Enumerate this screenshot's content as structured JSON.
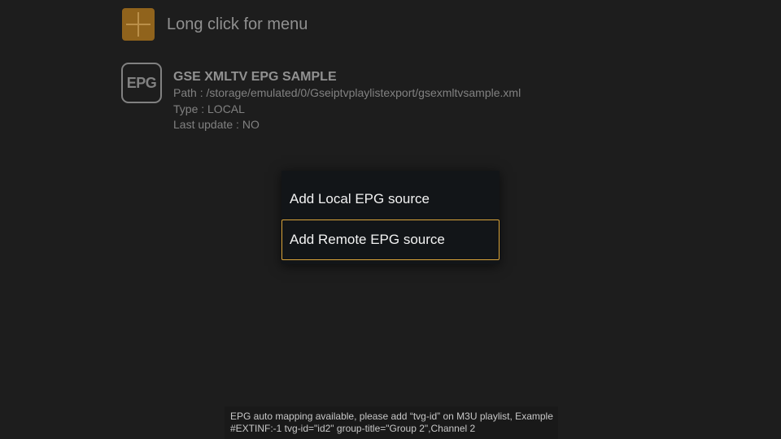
{
  "add_row": {
    "icon": "plus-icon",
    "label": "Long click for menu"
  },
  "epg_source": {
    "icon_text": "EPG",
    "title": "GSE XMLTV EPG SAMPLE",
    "path": "Path : /storage/emulated/0/Gseiptvplaylistexport/gsexmltvsample.xml",
    "type": "Type : LOCAL",
    "last_update": "Last update : NO"
  },
  "dialog": {
    "items": [
      {
        "label": "Add Local EPG source",
        "focused": false
      },
      {
        "label": "Add Remote EPG source",
        "focused": true
      }
    ]
  },
  "footer": {
    "line1": "EPG auto mapping available, please add “tvg-id” on M3U playlist, Example",
    "line2": "#EXTINF:-1 tvg-id=\"id2\" group-title=\"Group 2\",Channel 2"
  },
  "colors": {
    "background": "#1f1f1f",
    "accent": "#9a6a1e",
    "focus_border": "#d9a43a",
    "dialog_bg": "#121518"
  }
}
